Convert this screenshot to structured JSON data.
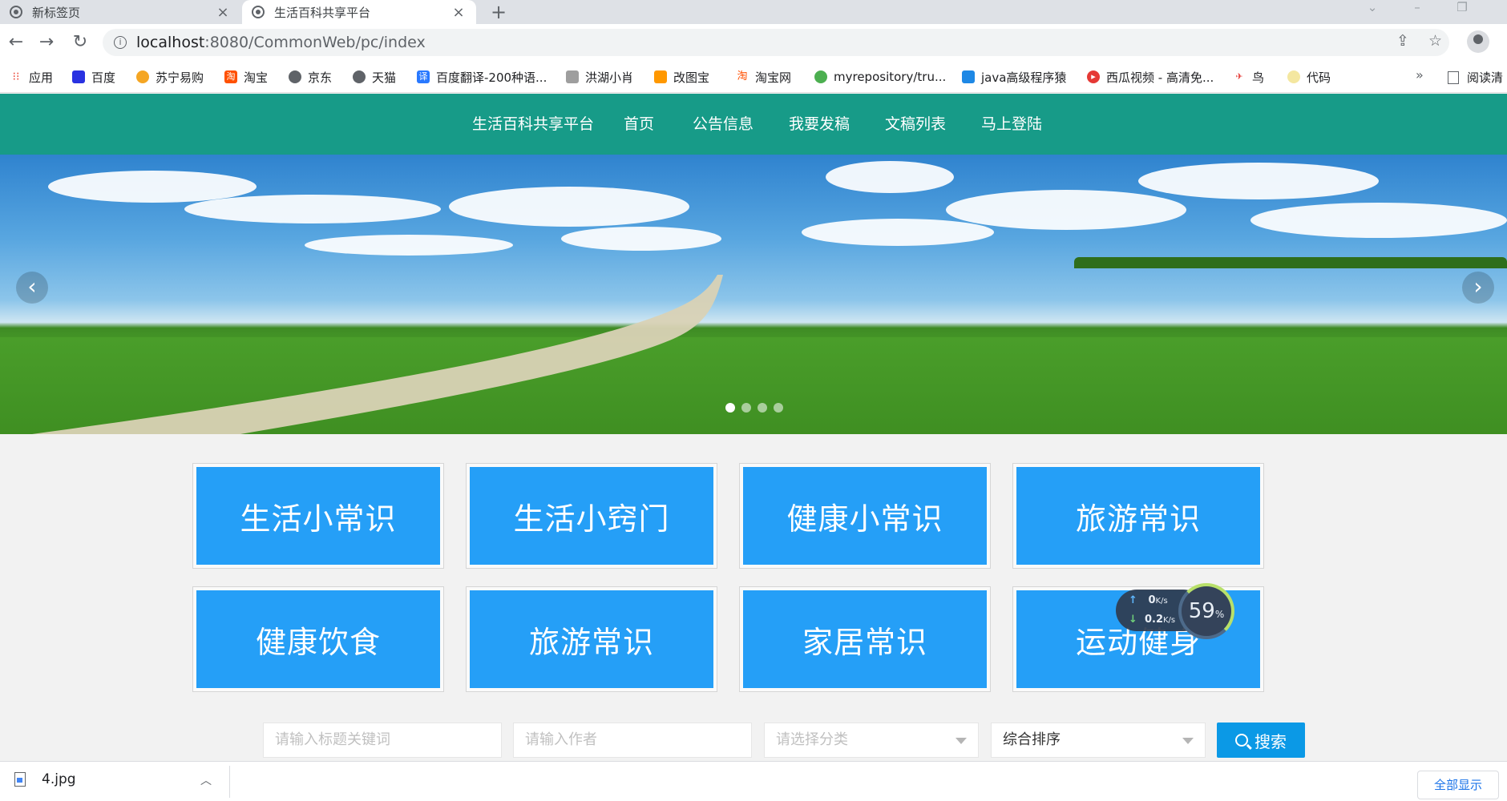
{
  "browser": {
    "tabs": [
      {
        "label": "新标签页",
        "active": false
      },
      {
        "label": "生活百科共享平台",
        "active": true
      }
    ],
    "new_tab_icon": "+",
    "url_host": "localhost",
    "url_rest": ":8080/CommonWeb/pc/index",
    "bookmarks": [
      {
        "label": "应用",
        "color": "#ea4335"
      },
      {
        "label": "百度",
        "color": "#2932e1"
      },
      {
        "label": "苏宁易购",
        "color": "#f5a623"
      },
      {
        "label": "淘宝",
        "color": "#ff5000"
      },
      {
        "label": "京东",
        "color": "#5f6368"
      },
      {
        "label": "天猫",
        "color": "#5f6368"
      },
      {
        "label": "百度翻译-200种语...",
        "color": "#2979ff"
      },
      {
        "label": "洪湖小肖",
        "color": "#7a7a7a"
      },
      {
        "label": "改图宝",
        "color": "#ff9800"
      },
      {
        "label": "淘宝网",
        "color": "#ff5000"
      },
      {
        "label": "myrepository/tru...",
        "color": "#4caf50"
      },
      {
        "label": "java高级程序猿",
        "color": "#1e88e5"
      },
      {
        "label": "西瓜视频 - 高清免...",
        "color": "#e53935"
      },
      {
        "label": "鸟",
        "color": "#e53935"
      },
      {
        "label": "代码",
        "color": "#f4c430"
      }
    ],
    "bookmarks_more": "»",
    "reading_list": "阅读清"
  },
  "site": {
    "nav": [
      "生活百科共享平台",
      "首页",
      "公告信息",
      "我要发稿",
      "文稿列表",
      "马上登陆"
    ],
    "banner": {
      "slides": 4,
      "active_slide": 1,
      "prev": "‹",
      "next": "›"
    },
    "categories": [
      "生活小常识",
      "生活小窍门",
      "健康小常识",
      "旅游常识",
      "健康饮食",
      "旅游常识",
      "家居常识",
      "运动健身"
    ],
    "search": {
      "title_placeholder": "请输入标题关键词",
      "author_placeholder": "请输入作者",
      "category_placeholder": "请选择分类",
      "sort_value": "综合排序",
      "button": "搜索"
    }
  },
  "speed_widget": {
    "up": "0",
    "up_unit": "K/s",
    "down": "0.2",
    "down_unit": "K/s",
    "percent": "59",
    "percent_unit": "%"
  },
  "downloads": {
    "file": "4.jpg",
    "show_all": "全部显示"
  }
}
